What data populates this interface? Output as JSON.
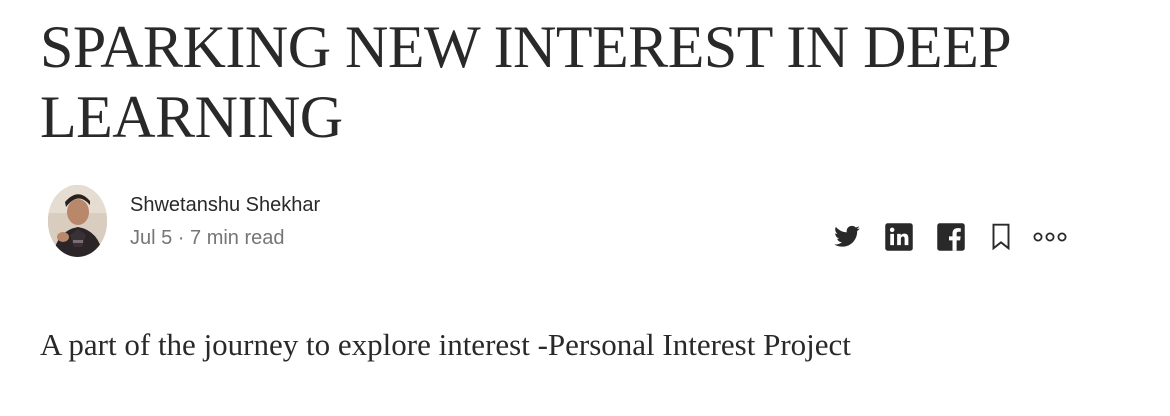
{
  "article": {
    "title": "SPARKING NEW INTEREST IN DEEP LEARNING",
    "subtitle": "A part of the journey to explore interest -Personal Interest Project"
  },
  "author": {
    "name": "Shwetanshu Shekhar",
    "date": "Jul 5",
    "read_time": "7 min read",
    "meta": "Jul 5 · 7 min read"
  },
  "actions": [
    {
      "icon": "twitter-icon"
    },
    {
      "icon": "linkedin-icon"
    },
    {
      "icon": "facebook-icon"
    },
    {
      "icon": "bookmark-icon"
    },
    {
      "icon": "more-options-icon"
    }
  ],
  "colors": {
    "text": "#292929",
    "muted": "#757575",
    "background": "#ffffff"
  }
}
